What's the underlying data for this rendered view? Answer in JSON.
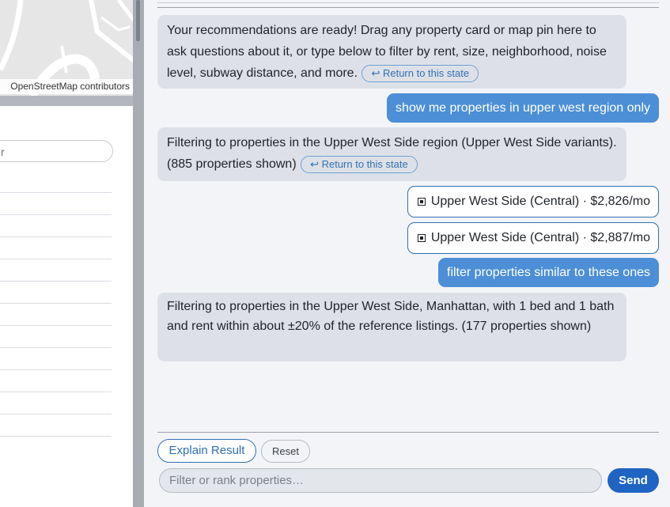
{
  "map": {
    "attribution": "OpenStreetMap contributors",
    "colors": {
      "land": "#e6e6e6",
      "road": "#ffffff"
    }
  },
  "sidebar": {
    "search_value": "r"
  },
  "chat": {
    "messages": [
      {
        "role": "bot",
        "text": "Your recommendations are ready! Drag any property card or map pin here to ask questions about it, or type below to filter by rent, size, neighborhood, noise level, subway distance, and more.",
        "return_label": "↩ Return to this state"
      },
      {
        "role": "user",
        "text": "show me properties in upper west region only"
      },
      {
        "role": "bot",
        "text": "Filtering to properties in the Upper West Side region (Upper West Side variants). (885 properties shown)",
        "return_label": "↩ Return to this state"
      },
      {
        "role": "chip",
        "text": "Upper West Side (Central) · $2,826/mo"
      },
      {
        "role": "chip",
        "text": "Upper West Side (Central) · $2,887/mo"
      },
      {
        "role": "user",
        "text": "filter properties similar to these ones"
      },
      {
        "role": "bot",
        "text": "Filtering to properties in the Upper West Side, Manhattan, with 1 bed and 1 bath and rent within about ±20% of the reference listings. (177 properties shown)"
      }
    ]
  },
  "controls": {
    "explain_label": "Explain Result",
    "reset_label": "Reset",
    "input_placeholder": "Filter or rank properties…",
    "send_label": "Send"
  },
  "colors": {
    "accent": "#1f64c2",
    "user_bubble": "#4c8fd6",
    "bot_bubble": "#dde1e7",
    "chip_border": "#2f6fb0"
  }
}
